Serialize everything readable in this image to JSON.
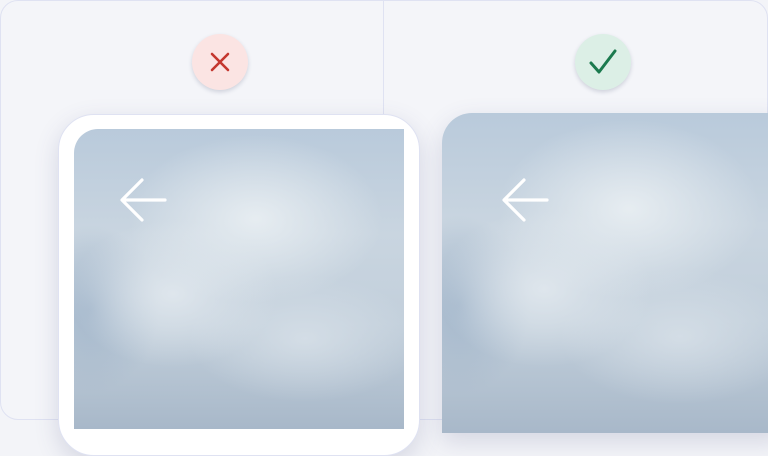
{
  "comparison": {
    "incorrect": {
      "status_icon": "close-x-icon",
      "status_color": "#c4372f",
      "badge_bg": "#fbe4e3",
      "back_icon": "arrow-left-icon"
    },
    "correct": {
      "status_icon": "checkmark-icon",
      "status_color": "#1b7a4e",
      "badge_bg": "#dcefe6",
      "back_icon": "arrow-left-icon"
    }
  },
  "colors": {
    "frame_border": "#dfe2f2",
    "background": "#f4f5f9",
    "bezel": "#ffffff"
  }
}
